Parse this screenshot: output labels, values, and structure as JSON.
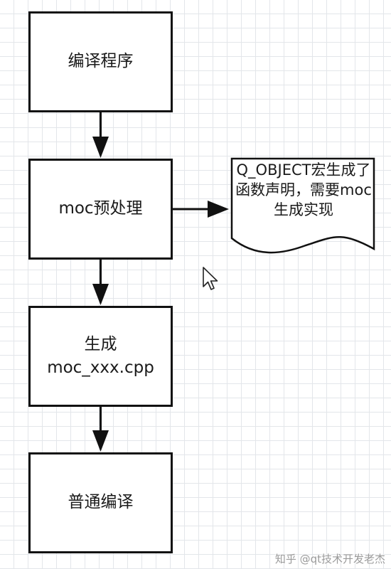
{
  "nodes": {
    "compile": {
      "label": "编译程序"
    },
    "moc_preprocess": {
      "label": "moc预处理"
    },
    "generate": {
      "line1": "生成",
      "line2": "moc_xxx.cpp"
    },
    "normal_compile": {
      "label": "普通编译"
    }
  },
  "note": {
    "text": "Q_OBJECT宏生成了函数声明，需要moc生成实现"
  },
  "watermark": {
    "text": "知乎 @qt技术开发老杰"
  },
  "colors": {
    "stroke": "#111111",
    "grid": "#e3e6ea",
    "background": "#ffffff"
  }
}
